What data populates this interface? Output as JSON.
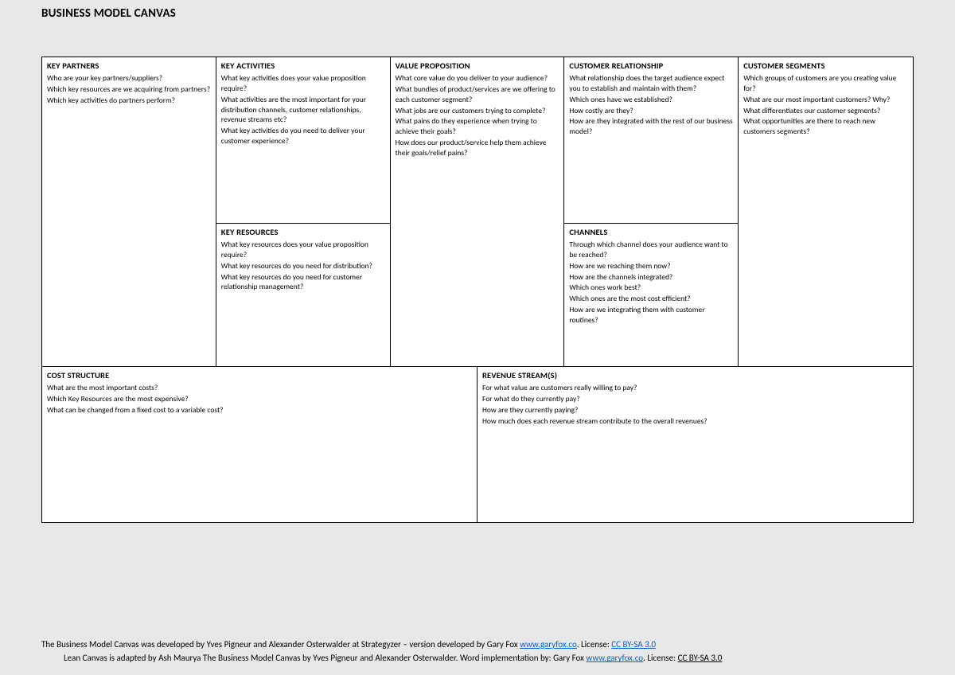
{
  "title": "BUSINESS MODEL CANVAS",
  "blocks": {
    "key_partners": {
      "heading": "KEY PARTNERS",
      "q1": "Who are your key partners/suppliers?",
      "q2": "Which key resources are we acquiring from partners?",
      "q3": "Which key activities do partners perform?"
    },
    "key_activities": {
      "heading": "KEY ACTIVITIES",
      "q1": "What key activities does your value proposition require?",
      "q2": "What activities are the most important for your distribution channels, customer relationships, revenue streams etc?",
      "q3": "What key activities do you need to deliver your customer experience?"
    },
    "key_resources": {
      "heading": "KEY RESOURCES",
      "q1": "What key resources does your value proposition require?",
      "q2": "What key resources do you need for distribution?",
      "q3": "What key resources do you need for customer relationship management?"
    },
    "value_proposition": {
      "heading": "VALUE PROPOSITION",
      "q1": "What core value do you deliver to your audience?",
      "q2": "What bundles of product/services are we offering to each customer segment?",
      "q3": "What jobs are our customers trying to complete?",
      "q4": "What pains do they experience when trying to achieve their goals?",
      "q5": "How does our product/service help them achieve their goals/relief pains?"
    },
    "customer_relationship": {
      "heading": "CUSTOMER RELATIONSHIP",
      "q1": "What relationship does the target audience expect you to establish and maintain with them?",
      "q2": "Which ones have we established?",
      "q3": "How costly are they?",
      "q4": "How are they integrated with the rest of our business model?"
    },
    "channels": {
      "heading": "CHANNELS",
      "q1": "Through which channel does your audience want to be reached?",
      "q2": "How are we reaching them now?",
      "q3": "How are the channels integrated?",
      "q4": "Which ones work best?",
      "q5": "Which ones are the most cost efficient?",
      "q6": "How are we integrating them with customer routines?"
    },
    "customer_segments": {
      "heading": "CUSTOMER SEGMENTS",
      "q1": "Which groups of customers are you creating value for?",
      "q2": "What are our most important customers? Why?",
      "q3": "What differentiates our customer segments?",
      "q4": "What opportunities are there to reach new customers segments?"
    },
    "cost_structure": {
      "heading": "COST STRUCTURE",
      "q1": "What are the most important costs?",
      "q2": "Which Key Resources are the most expensive?",
      "q3": "What can be changed from a fixed cost to a variable cost?"
    },
    "revenue_streams": {
      "heading": "REVENUE STREAM(S)",
      "q1": "For what value are customers really willing to pay?",
      "q2": "For what do they currently pay?",
      "q3": "How are they currently paying?",
      "q4": "How much does each revenue stream contribute to the overall revenues?"
    }
  },
  "footer": {
    "l1a": "The Business Model Canvas was developed by Yves Pigneur and Alexander Osterwalder at Strategyzer – version developed by Gary Fox ",
    "l1link": "www.garyfox.co",
    "l1b": ". License: ",
    "l1license": "CC BY-SA 3.0",
    "l2a": "Lean Canvas is adapted by Ash Maurya The Business Model Canvas by Yves Pigneur and Alexander Osterwalder. Word implementation by: Gary Fox ",
    "l2link": "www.garyfox.co",
    "l2b": ". License: ",
    "l2license": "CC BY-SA 3.0"
  }
}
